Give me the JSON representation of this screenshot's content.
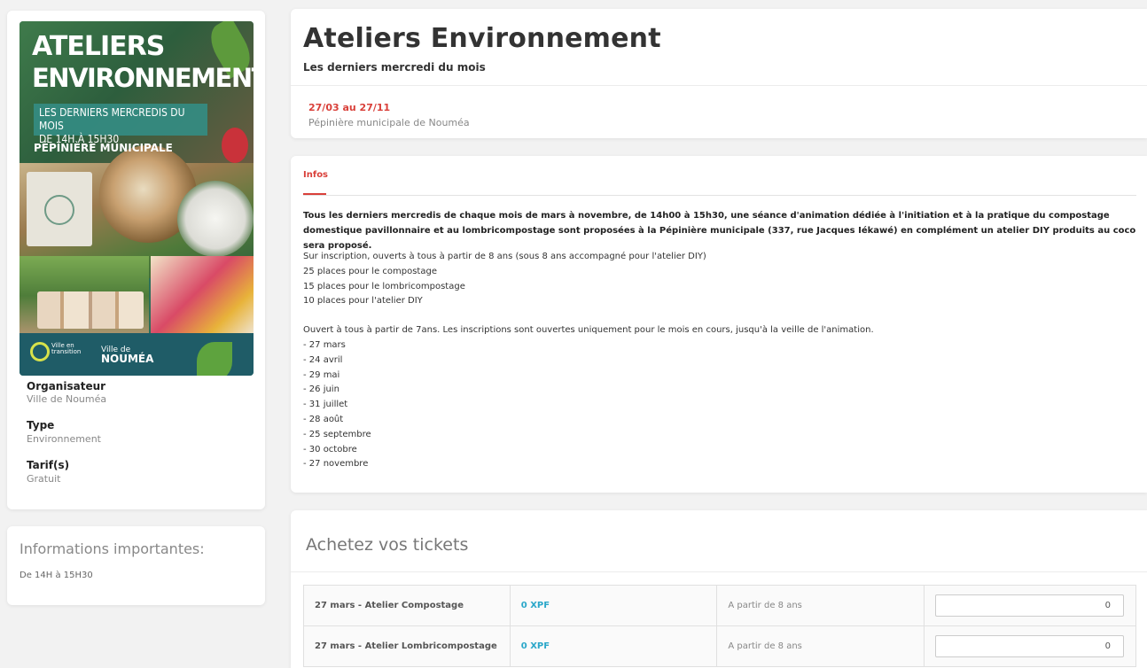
{
  "poster": {
    "title_line1": "ATELIERS",
    "title_line2": "ENVIRONNEMENT",
    "subtitle_line1": "LES DERNIERS MERCREDIS DU MOIS",
    "subtitle_line2": "DE 14H À 15H30",
    "venue": "PÉPINIÈRE MUNICIPALE",
    "logo_transition": "Ville en transition",
    "logo_ville_small": "Ville de",
    "logo_ville_big": "NOUMÉA"
  },
  "sidebar": {
    "organizer_label": "Organisateur",
    "organizer_value": "Ville de Nouméa",
    "type_label": "Type",
    "type_value": "Environnement",
    "tarif_label": "Tarif(s)",
    "tarif_value": "Gratuit",
    "important_title": "Informations importantes:",
    "important_text": "De 14H à 15H30"
  },
  "event": {
    "title": "Ateliers Environnement",
    "subtitle": "Les derniers mercredi du mois",
    "dates": "27/03 au 27/11",
    "place": "Pépinière municipale de Nouméa"
  },
  "infos": {
    "tab_label": "Infos",
    "lead": "Tous les derniers mercredis de chaque mois de mars à novembre, de 14h00 à 15h30, une séance d'animation dédiée à l'initiation et à la pratique du compostage domestique pavillonnaire et au lombricompostage sont proposées à la Pépinière municipale (337, rue Jacques Iékawé) en complément un atelier DIY produits au coco sera proposé.",
    "block1": [
      "Sur inscription, ouverts à tous à partir de 8 ans (sous 8 ans accompagné pour l'atelier DIY)",
      "25 places pour le compostage",
      "15 places pour le lombricompostage",
      "10 places pour l'atelier DIY"
    ],
    "block2": [
      "Ouvert à tous à partir de 7ans. Les inscriptions sont ouvertes uniquement pour le mois en cours, jusqu'à la veille de l'animation.",
      "- 27 mars",
      "- 24 avril",
      "- 29 mai",
      "- 26 juin",
      "- 31 juillet",
      "- 28 août",
      "- 25 septembre",
      "- 30 octobre",
      "- 27 novembre"
    ]
  },
  "tickets": {
    "title": "Achetez vos tickets",
    "rows": [
      {
        "name": "27 mars - Atelier Compostage",
        "price": "0 XPF",
        "age": "A partir de 8 ans",
        "qty": "0"
      },
      {
        "name": "27 mars - Atelier Lombricompostage",
        "price": "0 XPF",
        "age": "A partir de 8 ans",
        "qty": "0"
      }
    ]
  },
  "colors": {
    "accent_red": "#d9403a",
    "price_blue": "#2aa7c9",
    "poster_teal": "#1f5c67"
  }
}
